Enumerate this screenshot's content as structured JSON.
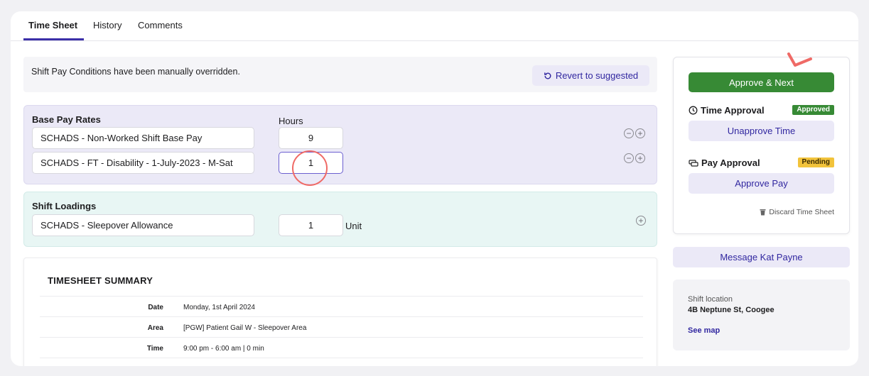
{
  "tabs": [
    {
      "label": "Time Sheet",
      "active": true
    },
    {
      "label": "History",
      "active": false
    },
    {
      "label": "Comments",
      "active": false
    }
  ],
  "notice": {
    "text": "Shift Pay Conditions have been manually overridden.",
    "revert_label": "Revert to suggested",
    "revert_icon": "refresh-icon"
  },
  "base_pay": {
    "title": "Base Pay Rates",
    "hours_label": "Hours",
    "rows": [
      {
        "name": "SCHADS - Non-Worked Shift Base Pay",
        "hours": "9"
      },
      {
        "name": "SCHADS - FT - Disability - 1-July-2023 - M-Sat",
        "hours": "1"
      }
    ]
  },
  "shift_loadings": {
    "title": "Shift Loadings",
    "rows": [
      {
        "name": "SCHADS - Sleepover Allowance",
        "qty": "1",
        "unit": "Unit"
      }
    ]
  },
  "summary": {
    "title": "TIMESHEET SUMMARY",
    "rows": [
      {
        "key": "Date",
        "value": "Monday, 1st April 2024"
      },
      {
        "key": "Area",
        "value": "[PGW] Patient Gail W - Sleepover Area"
      },
      {
        "key": "Time",
        "value": "9:00 pm - 6:00 am | 0 min"
      }
    ]
  },
  "approval": {
    "approve_next_label": "Approve & Next",
    "time_approval": {
      "label": "Time Approval",
      "status": "Approved",
      "action": "Unapprove Time"
    },
    "pay_approval": {
      "label": "Pay Approval",
      "status": "Pending",
      "action": "Approve Pay"
    },
    "discard_label": "Discard Time Sheet"
  },
  "message_label": "Message Kat Payne",
  "location": {
    "label": "Shift location",
    "address": "4B Neptune St, Coogee",
    "map_link": "See map"
  },
  "colors": {
    "accent": "#3127a0",
    "approve_green": "#378a35",
    "pending_yellow": "#f2c33b",
    "annotation_red": "#ef6a66"
  }
}
